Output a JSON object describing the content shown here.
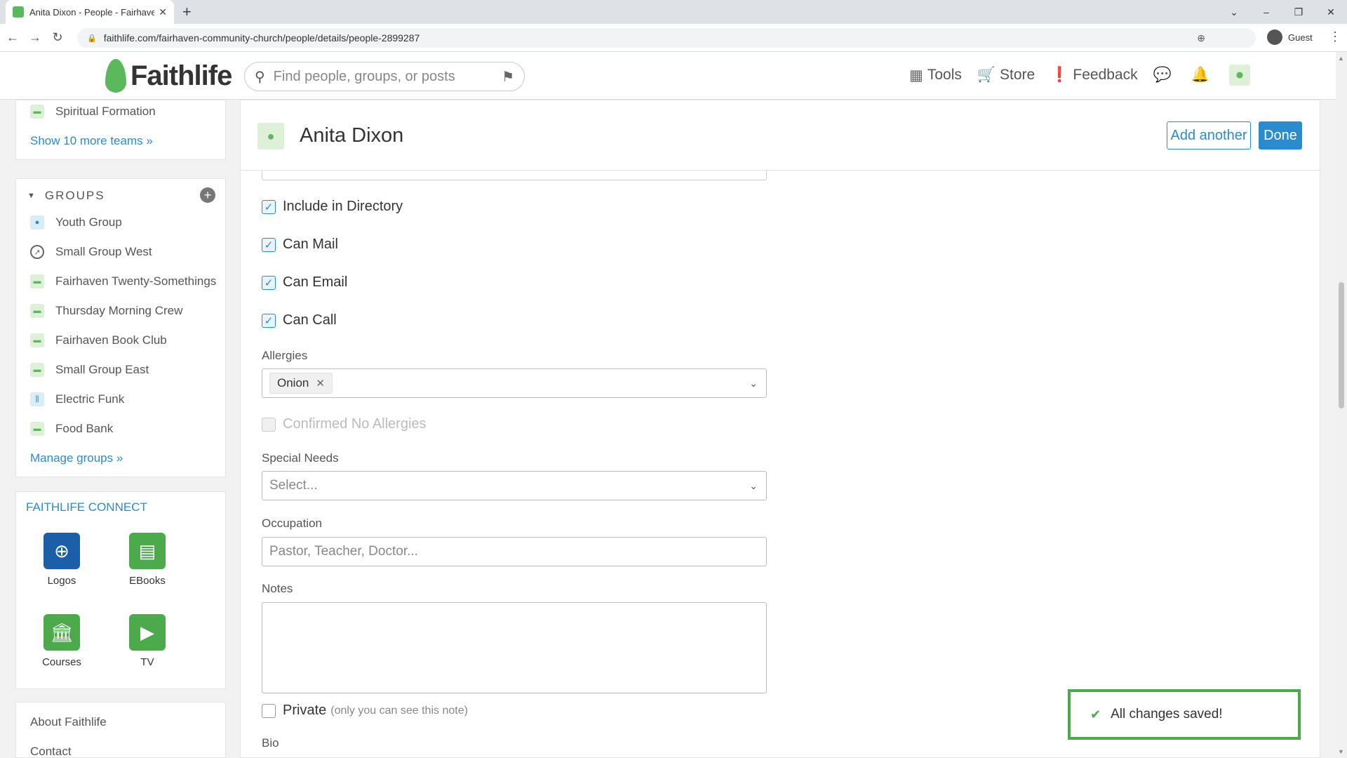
{
  "browser": {
    "tab_title": "Anita Dixon - People - Fairhaven",
    "url": "faithlife.com/fairhaven-community-church/people/details/people-2899287",
    "profile": "Guest"
  },
  "header": {
    "logo": "Faithlife",
    "search_placeholder": "Find people, groups, or posts",
    "nav": {
      "tools": "Tools",
      "store": "Store",
      "feedback": "Feedback"
    }
  },
  "sidebar": {
    "teams_last": "Spiritual Formation",
    "show_more_teams": "Show 10 more teams »",
    "groups_title": "GROUPS",
    "groups": [
      {
        "label": "Youth Group"
      },
      {
        "label": "Small Group West"
      },
      {
        "label": "Fairhaven Twenty-Somethings"
      },
      {
        "label": "Thursday Morning Crew"
      },
      {
        "label": "Fairhaven Book Club"
      },
      {
        "label": "Small Group East"
      },
      {
        "label": "Electric Funk"
      },
      {
        "label": "Food Bank"
      }
    ],
    "manage_groups": "Manage groups »",
    "connect_title": "FAITHLIFE CONNECT",
    "apps": [
      {
        "label": "Logos"
      },
      {
        "label": "EBooks"
      },
      {
        "label": "Courses"
      },
      {
        "label": "TV"
      }
    ],
    "footer_links": [
      "About Faithlife",
      "Contact"
    ]
  },
  "person": {
    "name": "Anita Dixon",
    "add_another": "Add another",
    "done": "Done"
  },
  "form": {
    "include_directory": {
      "label": "Include in Directory",
      "checked": true
    },
    "can_mail": {
      "label": "Can Mail",
      "checked": true
    },
    "can_email": {
      "label": "Can Email",
      "checked": true
    },
    "can_call": {
      "label": "Can Call",
      "checked": true
    },
    "allergies_label": "Allergies",
    "allergies": [
      "Onion"
    ],
    "confirmed_no_allergies": {
      "label": "Confirmed No Allergies",
      "checked": false,
      "disabled": true
    },
    "special_needs_label": "Special Needs",
    "special_needs_placeholder": "Select...",
    "occupation_label": "Occupation",
    "occupation_placeholder": "Pastor, Teacher, Doctor...",
    "notes_label": "Notes",
    "private_label": "Private",
    "private_hint": "(only you can see this note)",
    "bio_label": "Bio"
  },
  "toast": {
    "message": "All changes saved!"
  },
  "colors": {
    "accent": "#2a8ccf",
    "brand_green": "#5cb85c",
    "toast_border": "#4caa4c"
  }
}
